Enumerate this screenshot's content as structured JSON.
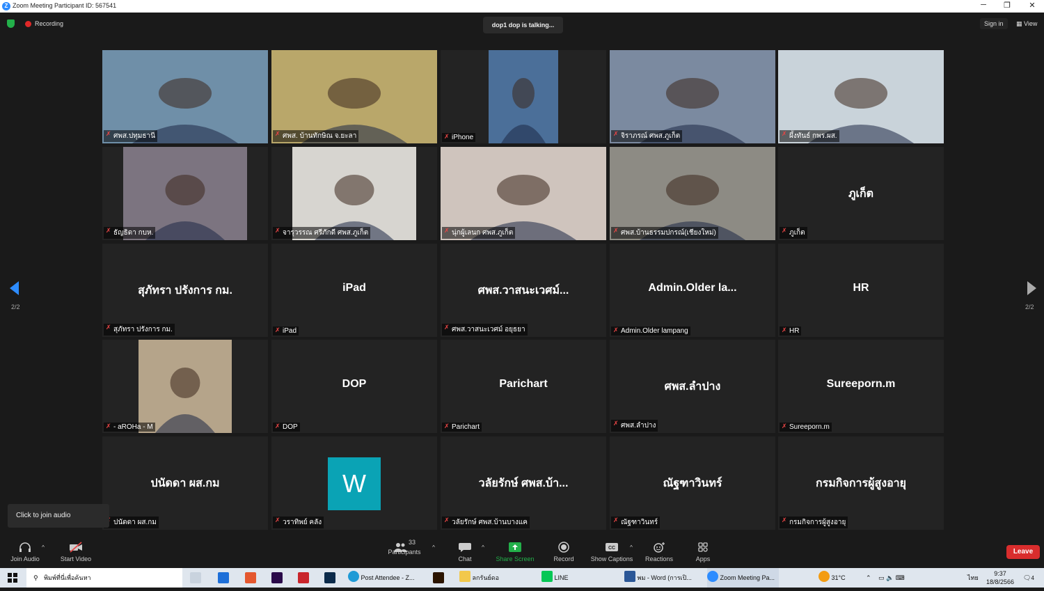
{
  "window": {
    "title": "Zoom Meeting Participant ID: 567541",
    "logo_letter": "Z",
    "minimize": "─",
    "restore": "❐",
    "close": "✕"
  },
  "topbar": {
    "recording": "Recording",
    "talking": "dop1 dop is talking...",
    "signin": "Sign in",
    "view": "View"
  },
  "tiles": [
    {
      "label": "ศพส.ปทุมธานี",
      "big": "",
      "video": true,
      "bg": "#6f8fa8"
    },
    {
      "label": "ศพส. บ้านทักษิณ จ.ยะลา",
      "big": "",
      "video": true,
      "bg": "#b9a76a"
    },
    {
      "label": "iPhone",
      "big": "",
      "video": true,
      "bg": "#4b6f99"
    },
    {
      "label": "จิราภรณ์ ศพส.ภูเก็ต",
      "big": "",
      "video": true,
      "bg": "#7b8aa0"
    },
    {
      "label": "ผึ้งทันธ์ กพร.ผส.",
      "big": "",
      "video": true,
      "bg": "#c9d3da"
    },
    {
      "label": "ธัญธิดา กบห.",
      "big": "",
      "video": true,
      "bg": "#7c7480"
    },
    {
      "label": "จารุวรรณ ศรีภักดี ศพส.ภูเก็ต",
      "big": "",
      "video": true,
      "bg": "#d7d5d0"
    },
    {
      "label": "นุ่กผู้เลนก ศพส.ภูเก็ต",
      "big": "",
      "video": true,
      "bg": "#cfc4bd"
    },
    {
      "label": "ศพส.บ้านธรรมปกรณ์(เชียงใหม่)",
      "big": "",
      "video": true,
      "bg": "#8d8b84"
    },
    {
      "label": "ภูเก็ต",
      "big": "ภูเก็ต",
      "video": false,
      "bg": ""
    },
    {
      "label": "สุภัทรา ปรังการ กม.",
      "big": "สุภัทรา ปรังการ กม.",
      "video": false,
      "bg": ""
    },
    {
      "label": "iPad",
      "big": "iPad",
      "video": false,
      "bg": ""
    },
    {
      "label": "ศพส.วาสนะเวศม์ อยุธยา",
      "big": "ศพส.วาสนะเวศม์...",
      "video": false,
      "bg": ""
    },
    {
      "label": "Admin.Older lampang",
      "big": "Admin.Older la...",
      "video": false,
      "bg": ""
    },
    {
      "label": "HR",
      "big": "HR",
      "video": false,
      "bg": ""
    },
    {
      "label": "- aROHa - M",
      "big": "",
      "video": true,
      "bg": "#b5a48a"
    },
    {
      "label": "DOP",
      "big": "DOP",
      "video": false,
      "bg": ""
    },
    {
      "label": "Parichart",
      "big": "Parichart",
      "video": false,
      "bg": ""
    },
    {
      "label": "ศพส.ลำปาง",
      "big": "ศพส.ลำปาง",
      "video": false,
      "bg": ""
    },
    {
      "label": "Sureeporn.m",
      "big": "Sureeporn.m",
      "video": false,
      "bg": ""
    },
    {
      "label": "ปนัดดา ผส.กม",
      "big": "ปนัดดา ผส.กม",
      "video": false,
      "bg": ""
    },
    {
      "label": "วราทิพย์ คลัง",
      "big": "W",
      "video": false,
      "bg": ""
    },
    {
      "label": "วลัยรักษ์ ศพส.บ้านบางแค",
      "big": "วลัยรักษ์ ศพส.บ้า...",
      "video": false,
      "bg": ""
    },
    {
      "label": "ณัฐฑาวินทร์",
      "big": "ณัฐฑาวินทร์",
      "video": false,
      "bg": ""
    },
    {
      "label": "กรมกิจการผู้สูงอายุ",
      "big": "กรมกิจการผู้สูงอายุ",
      "video": false,
      "bg": ""
    }
  ],
  "pages": {
    "left": "2/2",
    "right": "2/2"
  },
  "tooltip": "Click to join audio",
  "toolbar": {
    "join_audio": "Join Audio",
    "start_video": "Start Video",
    "participants": "Participants",
    "participants_count": "33",
    "chat": "Chat",
    "share_screen": "Share Screen",
    "record": "Record",
    "show_captions": "Show Captions",
    "reactions": "Reactions",
    "apps": "Apps",
    "leave": "Leave",
    "cc": "CC",
    "caret": "^"
  },
  "taskbar": {
    "search": "พิมพ์ที่นี่เพื่อค้นหา",
    "edge": "Post Attendee - Z...",
    "folder": "ลกรันย์ดอ",
    "line": "LINE",
    "word": "พม - Word (การเปิ...",
    "zoom": "Zoom Meeting Pa...",
    "temp": "31°C",
    "lang": "ไทย",
    "time": "9:37",
    "date": "18/8/2566",
    "notif": "4"
  },
  "colors": {
    "zoom_blue": "#2d8cff",
    "leave_red": "#d92d2d",
    "share_green": "#23b04a",
    "w_teal": "#0aa3b5"
  }
}
